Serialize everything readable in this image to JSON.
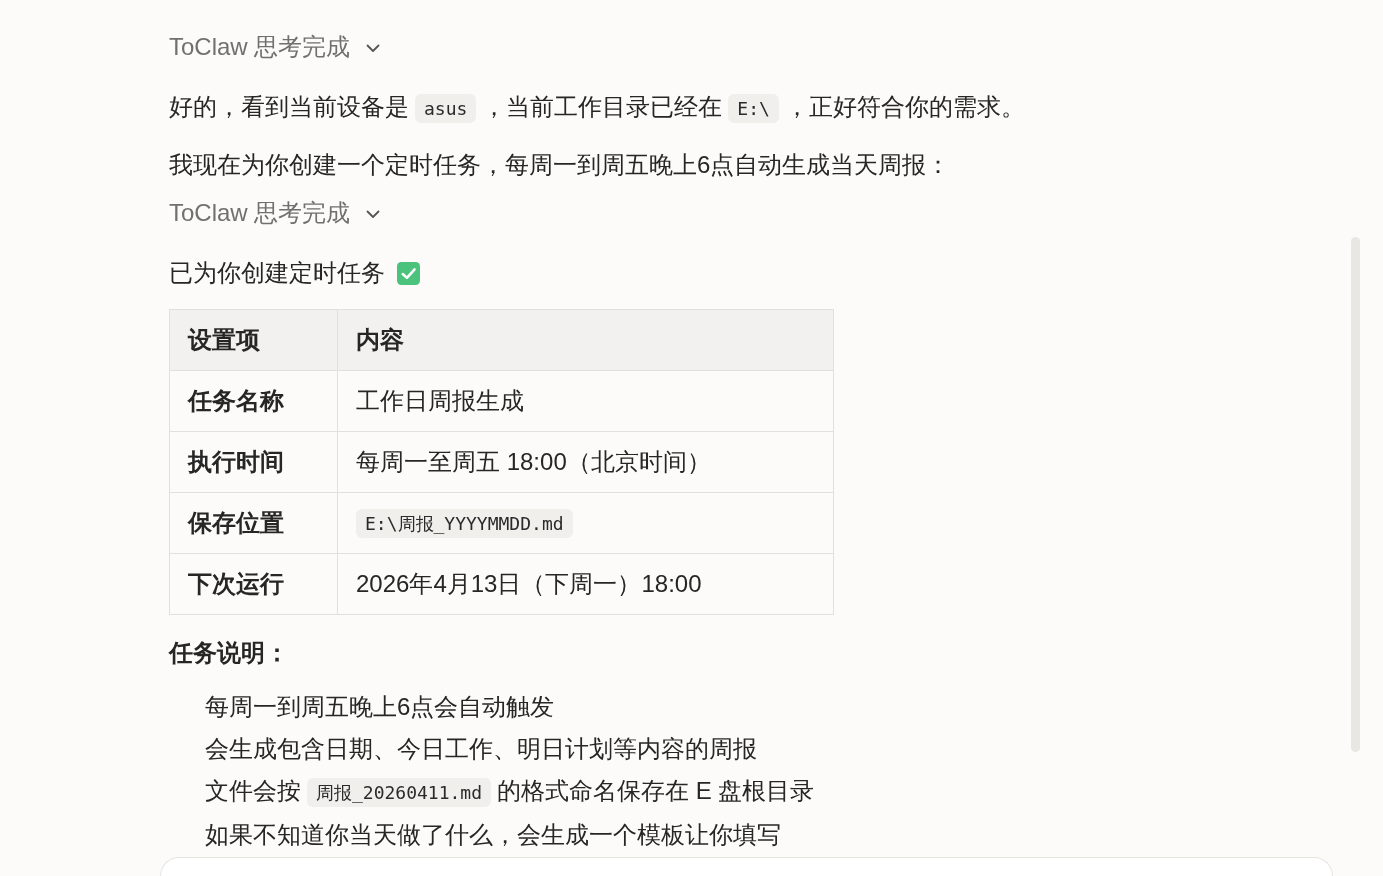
{
  "messages": [
    {
      "kind": "thinking",
      "label": "ToClaw 思考完成",
      "expanded": false
    },
    {
      "kind": "paragraph",
      "segments": [
        {
          "kind": "text",
          "text": "好的，看到当前设备是"
        },
        {
          "kind": "code",
          "text": "asus"
        },
        {
          "kind": "text",
          "text": "，当前工作目录已经在"
        },
        {
          "kind": "code",
          "text": "E:\\"
        },
        {
          "kind": "text",
          "text": "，正好符合你的需求。"
        }
      ]
    },
    {
      "kind": "paragraph",
      "segments": [
        {
          "kind": "text",
          "text": "我现在为你创建一个定时任务，每周一到周五晚上6点自动生成当天周报："
        }
      ]
    },
    {
      "kind": "thinking",
      "label": "ToClaw 思考完成",
      "expanded": false
    },
    {
      "kind": "paragraph",
      "segments": [
        {
          "kind": "text",
          "text": "已为你创建定时任务"
        }
      ],
      "done": true
    },
    {
      "kind": "table",
      "columns": [
        "设置项",
        "内容"
      ],
      "rows": [
        {
          "label": "任务名称",
          "value": [
            {
              "kind": "text",
              "text": "工作日周报生成"
            }
          ]
        },
        {
          "label": "执行时间",
          "value": [
            {
              "kind": "text",
              "text": "每周一至周五 18:00（北京时间）"
            }
          ]
        },
        {
          "label": "保存位置",
          "value": [
            {
              "kind": "code",
              "text": "E:\\周报_YYYYMMDD.md"
            }
          ]
        },
        {
          "label": "下次运行",
          "value": [
            {
              "kind": "text",
              "text": "2026年4月13日（下周一）18:00"
            }
          ]
        }
      ]
    },
    {
      "kind": "heading",
      "text": "任务说明："
    },
    {
      "kind": "list",
      "items": [
        [
          {
            "kind": "text",
            "text": "每周一到周五晚上6点会自动触发"
          }
        ],
        [
          {
            "kind": "text",
            "text": "会生成包含日期、今日工作、明日计划等内容的周报"
          }
        ],
        [
          {
            "kind": "text",
            "text": "文件会按"
          },
          {
            "kind": "code",
            "text": "周报_20260411.md"
          },
          {
            "kind": "text",
            "text": "的格式命名保存在 E 盘根目录"
          }
        ],
        [
          {
            "kind": "text",
            "text": "如果不知道你当天做了什么，会生成一个模板让你填写"
          }
        ]
      ]
    }
  ]
}
